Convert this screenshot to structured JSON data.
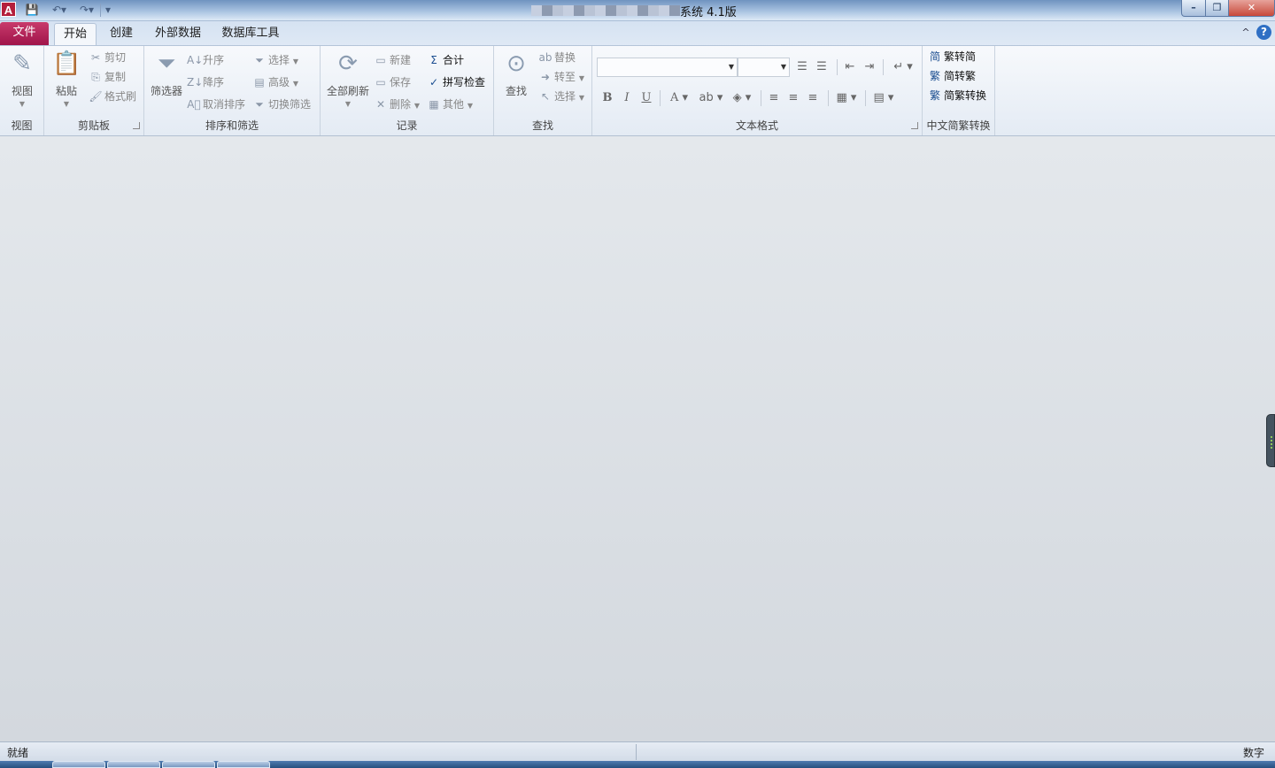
{
  "window": {
    "title": "系统 4.1版",
    "controls": {
      "minimize": "–",
      "maximize": "❐",
      "close": "✕"
    }
  },
  "quick_access": [
    {
      "name": "save",
      "icon": "💾"
    },
    {
      "name": "undo",
      "icon": "↶▾"
    },
    {
      "name": "redo",
      "icon": "↷▾"
    },
    {
      "name": "customize",
      "icon": "▾"
    }
  ],
  "tabs": {
    "file": "文件",
    "home": "开始",
    "create": "创建",
    "external": "外部数据",
    "dbtools": "数据库工具"
  },
  "ribbon_controls": {
    "collapse": "^",
    "help": "?"
  },
  "groups": {
    "view": {
      "label": "视图",
      "view_button": "视图",
      "icon": "✎"
    },
    "clipboard": {
      "label": "剪贴板",
      "paste": "粘贴",
      "cut": "剪切",
      "copy": "复制",
      "format_painter": "格式刷"
    },
    "sort_filter": {
      "label": "排序和筛选",
      "filter": "筛选器",
      "ascending": "升序",
      "descending": "降序",
      "remove_sort": "取消排序",
      "selection": "选择",
      "advanced": "高级",
      "toggle_filter": "切换筛选"
    },
    "records": {
      "label": "记录",
      "refresh_all": "全部刷新",
      "new": "新建",
      "save": "保存",
      "delete": "删除",
      "totals": "合计",
      "spelling": "拼写检查",
      "more": "其他"
    },
    "find": {
      "label": "查找",
      "find": "查找",
      "replace": "替换",
      "goto": "转至",
      "select": "选择"
    },
    "text_format": {
      "label": "文本格式",
      "font_name": "",
      "font_size": "",
      "bold": "B",
      "italic": "I",
      "underline": "U"
    },
    "chinese_conversion": {
      "label": "中文简繁转换",
      "trad_to_simp": "繁转简",
      "simp_to_trad": "简转繁",
      "convert": "简繁转换"
    }
  },
  "status_bar": {
    "left": "就绪",
    "right": "数字"
  }
}
